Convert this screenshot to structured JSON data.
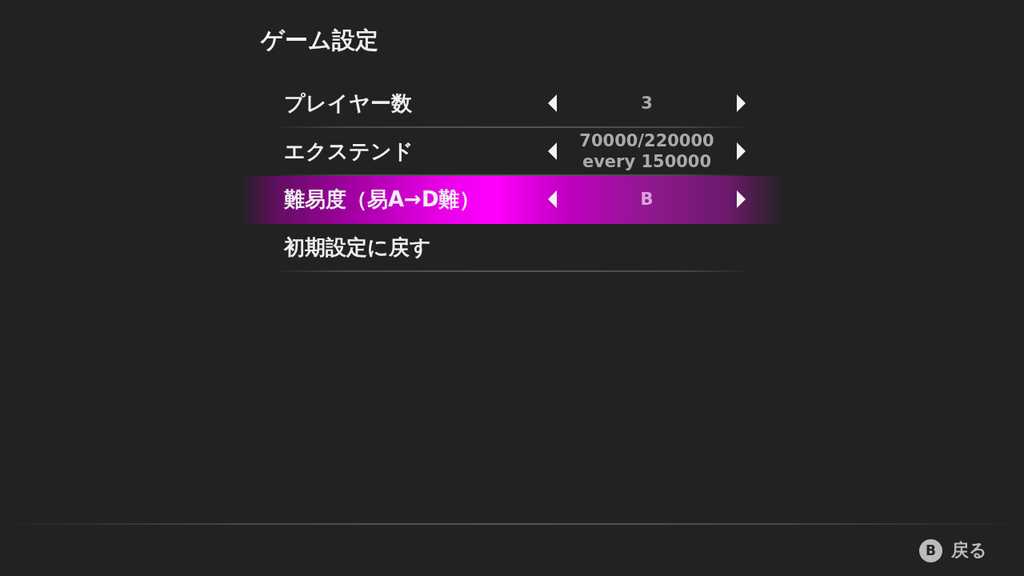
{
  "screen": {
    "title": "ゲーム設定"
  },
  "settings": [
    {
      "kind": "option",
      "label": "プレイヤー数",
      "value_lines": [
        "3"
      ],
      "selected": false
    },
    {
      "kind": "option",
      "label": "エクステンド",
      "value_lines": [
        "70000/220000",
        "every 150000"
      ],
      "selected": false
    },
    {
      "kind": "option",
      "label": "難易度（易A→D難）",
      "value_lines": [
        "B"
      ],
      "selected": true
    },
    {
      "kind": "action",
      "label": "初期設定に戻す",
      "selected": false
    }
  ],
  "footer": {
    "key_glyph": "B",
    "label": "戻る"
  }
}
